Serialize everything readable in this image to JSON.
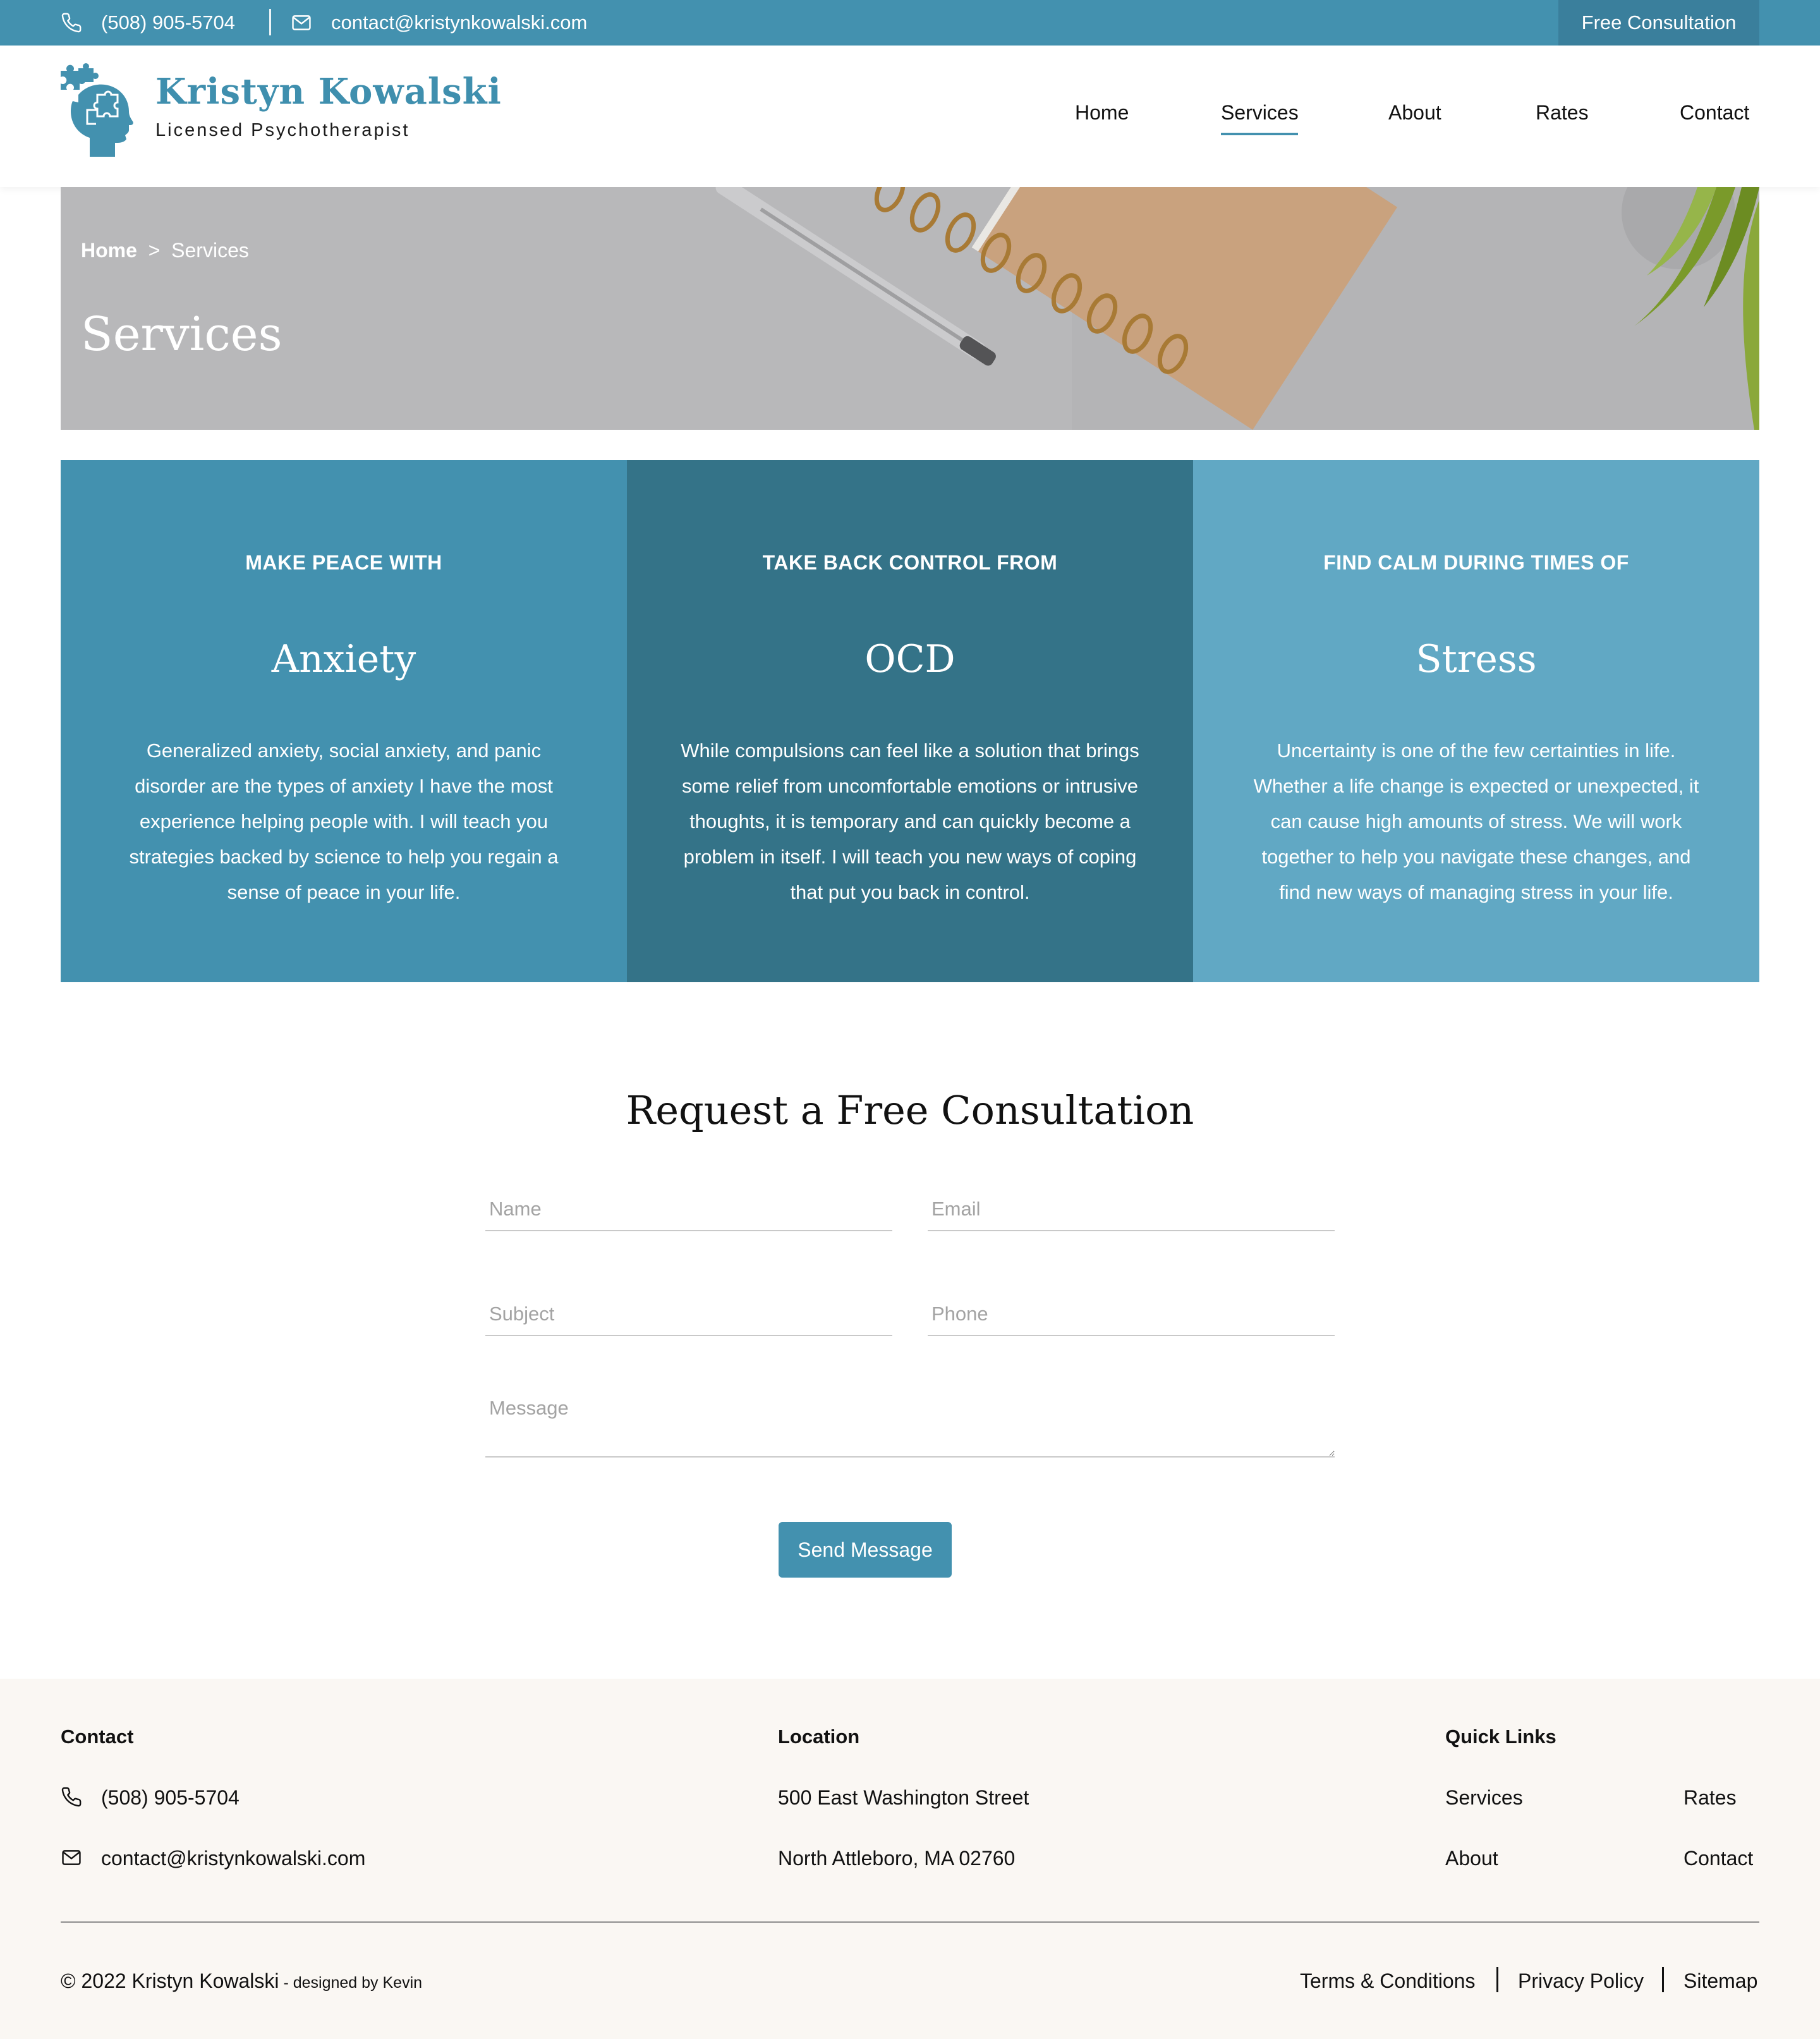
{
  "topbar": {
    "phone": "(508) 905-5704",
    "email": "contact@kristynkowalski.com",
    "cta": "Free Consultation"
  },
  "brand": {
    "name": "Kristyn Kowalski",
    "subtitle": "Licensed Psychotherapist"
  },
  "nav": {
    "items": [
      {
        "label": "Home"
      },
      {
        "label": "Services",
        "active": true
      },
      {
        "label": "About"
      },
      {
        "label": "Rates"
      },
      {
        "label": "Contact"
      }
    ]
  },
  "hero": {
    "breadcrumb_home": "Home",
    "breadcrumb_sep": ">",
    "breadcrumb_current": "Services",
    "title": "Services"
  },
  "services": [
    {
      "kicker": "MAKE PEACE WITH",
      "title": "Anxiety",
      "description": "Generalized anxiety, social anxiety, and panic disorder are the types of anxiety I have the most experience helping people with. I will teach you strategies backed by science to help you regain a sense of peace in your life.",
      "color": "#4391af"
    },
    {
      "kicker": "TAKE BACK CONTROL FROM",
      "title": "OCD",
      "description": "While compulsions can feel like a solution that brings some relief from uncomfortable emotions or intrusive thoughts, it is temporary and can quickly become a problem in itself. I will teach you new ways of coping that put you back in control.",
      "color": "#347388"
    },
    {
      "kicker": "FIND CALM DURING TIMES OF",
      "title": "Stress",
      "description": "Uncertainty is one of the few certainties in life. Whether a life change is expected or unexpected, it can cause high amounts of stress.  We will work together to help you navigate these changes, and find new ways of managing stress in your life.",
      "color": "#61a8c4"
    }
  ],
  "form": {
    "title": "Request a Free Consultation",
    "name_placeholder": "Name",
    "email_placeholder": "Email",
    "subject_placeholder": "Subject",
    "phone_placeholder": "Phone",
    "message_placeholder": "Message",
    "submit": "Send Message"
  },
  "footer": {
    "contact_heading": "Contact",
    "phone": "(508) 905-5704",
    "email": "contact@kristynkowalski.com",
    "location_heading": "Location",
    "address_line1": "500 East Washington Street",
    "address_line2": "North Attleboro, MA 02760",
    "quicklinks_heading": "Quick Links",
    "links": [
      "Services",
      "Rates",
      "About",
      "Contact"
    ],
    "copyright": "© 2022 Kristyn Kowalski",
    "designed_by": " - designed by Kevin",
    "legal": [
      "Terms & Conditions",
      "Privacy Policy",
      "Sitemap"
    ]
  },
  "colors": {
    "primary": "#4391af",
    "primary_dark": "#3a7f9c",
    "card_mid": "#347388",
    "card_light": "#61a8c4",
    "footer_bg": "#faf7f3"
  },
  "icons": [
    "phone-icon",
    "mail-icon",
    "head-puzzle-logo-icon"
  ]
}
